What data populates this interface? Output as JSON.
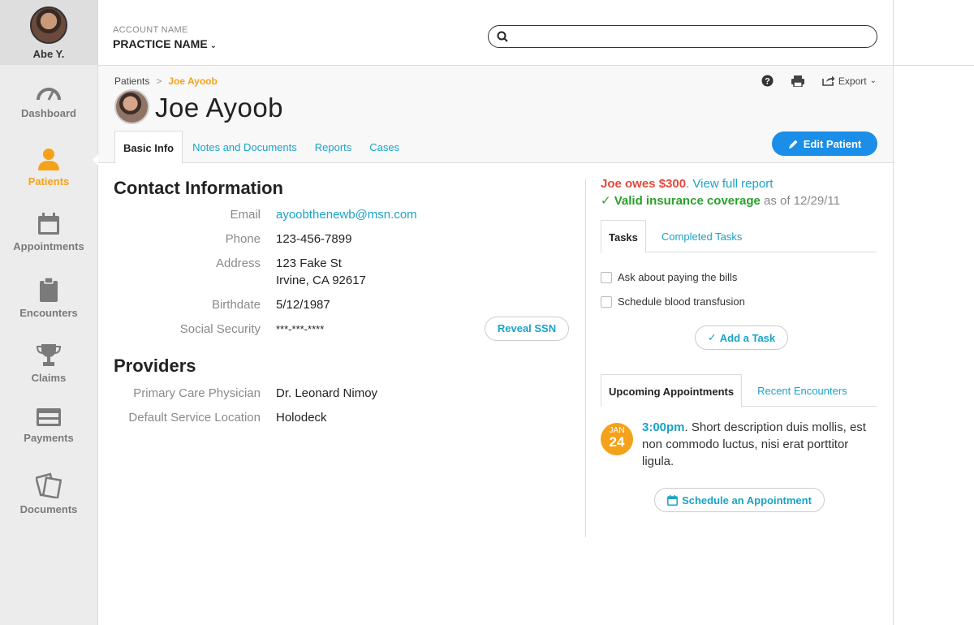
{
  "user": {
    "name": "Abe Y."
  },
  "nav": [
    {
      "label": "Dashboard",
      "icon": "dashboard-gauge-icon"
    },
    {
      "label": "Patients",
      "icon": "patient-person-icon",
      "active": true
    },
    {
      "label": "Appointments",
      "icon": "calendar-icon"
    },
    {
      "label": "Encounters",
      "icon": "clipboard-icon"
    },
    {
      "label": "Claims",
      "icon": "trophy-icon"
    },
    {
      "label": "Payments",
      "icon": "credit-card-icon"
    },
    {
      "label": "Documents",
      "icon": "documents-icon"
    }
  ],
  "account": {
    "label": "ACCOUNT NAME",
    "name": "PRACTICE NAME"
  },
  "search": {
    "placeholder": ""
  },
  "breadcrumb": {
    "parent": "Patients",
    "separator": ">",
    "current": "Joe Ayoob"
  },
  "patient": {
    "name": "Joe Ayoob"
  },
  "header_actions": {
    "export_label": "Export"
  },
  "tabs": [
    "Basic Info",
    "Notes and Documents",
    "Reports",
    "Cases"
  ],
  "edit_button": "Edit Patient",
  "contact": {
    "title": "Contact Information",
    "email_label": "Email",
    "email": "ayoobthenewb@msn.com",
    "phone_label": "Phone",
    "phone": "123-456-7899",
    "address_label": "Address",
    "address_line1": "123 Fake St",
    "address_line2": "Irvine, CA 92617",
    "birthdate_label": "Birthdate",
    "birthdate": "5/12/1987",
    "ssn_label": "Social Security",
    "ssn": "***-***-****",
    "reveal_label": "Reveal SSN"
  },
  "providers": {
    "title": "Providers",
    "pcp_label": "Primary Care Physician",
    "pcp": "Dr. Leonard Nimoy",
    "location_label": "Default Service Location",
    "location": "Holodeck"
  },
  "billing": {
    "owes_prefix": "Joe owes $300",
    "owes_suffix": ".",
    "report_link": "View full report",
    "valid": "✓ Valid insurance coverage",
    "as_of": "as of 12/29/11"
  },
  "task_tabs": [
    "Tasks",
    "Completed Tasks"
  ],
  "tasks": [
    "Ask about paying the bills",
    "Schedule blood transfusion"
  ],
  "add_task": "Add a Task",
  "appt_tabs": [
    "Upcoming Appointments",
    "Recent Encounters"
  ],
  "appointment": {
    "month": "JAN",
    "day": "24",
    "time": "3:00pm",
    "description": ". Short description duis mollis, est non commodo luctus, nisi erat porttitor ligula."
  },
  "schedule_button": "Schedule an Appointment",
  "colors": {
    "accent_orange": "#f5a21b",
    "link_blue": "#1aa3c8",
    "button_blue": "#1a8ee8",
    "owes_red": "#e04a3c",
    "valid_green": "#2aa02a"
  }
}
